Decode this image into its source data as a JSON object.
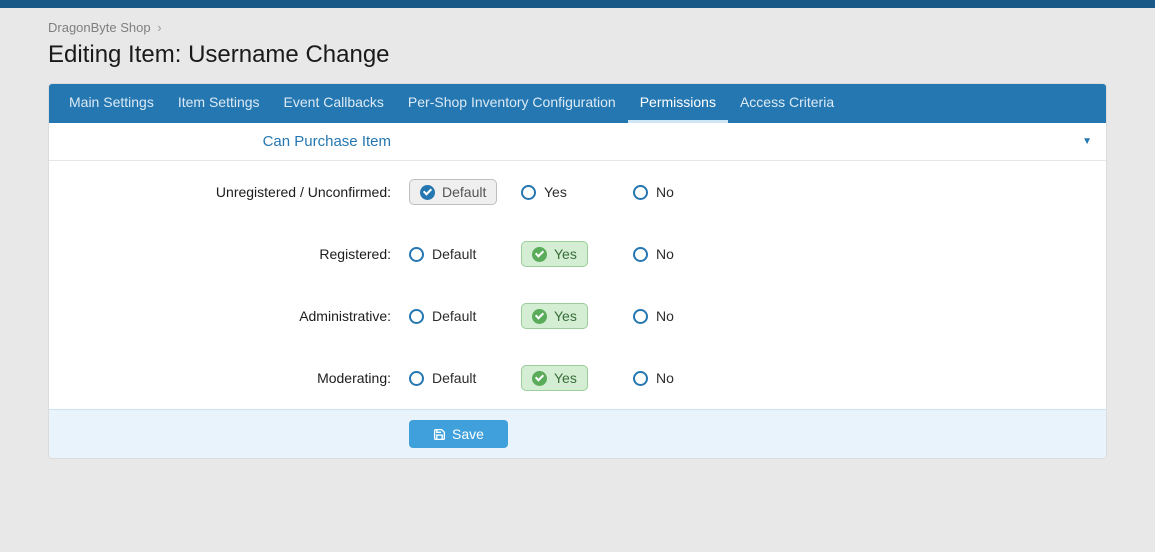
{
  "breadcrumb": {
    "parent": "DragonByte Shop"
  },
  "page_title": "Editing Item: Username Change",
  "tabs": [
    {
      "label": "Main Settings",
      "active": false
    },
    {
      "label": "Item Settings",
      "active": false
    },
    {
      "label": "Event Callbacks",
      "active": false
    },
    {
      "label": "Per-Shop Inventory Configuration",
      "active": false
    },
    {
      "label": "Permissions",
      "active": true
    },
    {
      "label": "Access Criteria",
      "active": false
    }
  ],
  "section": {
    "title": "Can Purchase Item"
  },
  "option_labels": {
    "default": "Default",
    "yes": "Yes",
    "no": "No"
  },
  "rows": [
    {
      "label": "Unregistered / Unconfirmed:",
      "selected": "default"
    },
    {
      "label": "Registered:",
      "selected": "yes"
    },
    {
      "label": "Administrative:",
      "selected": "yes"
    },
    {
      "label": "Moderating:",
      "selected": "yes"
    }
  ],
  "footer": {
    "save_label": "Save"
  }
}
